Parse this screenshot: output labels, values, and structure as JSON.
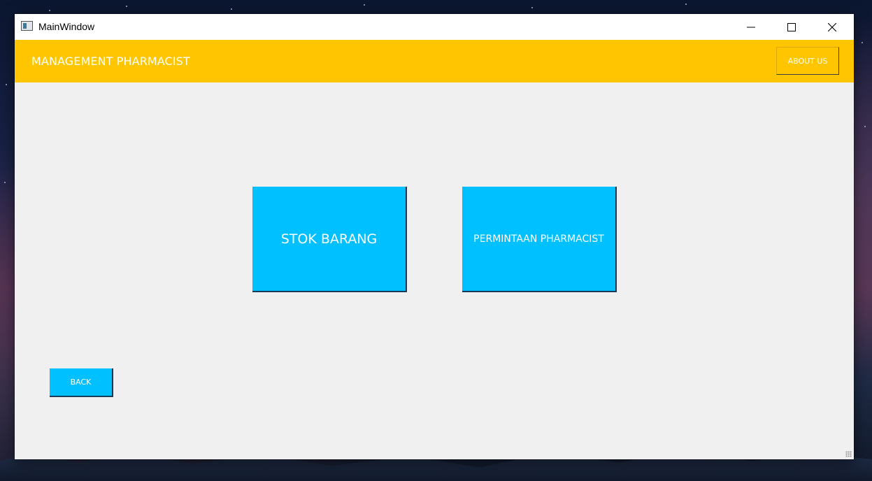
{
  "window": {
    "title": "MainWindow",
    "icons": {
      "app": "app-window-icon",
      "minimize": "minimize-icon",
      "maximize": "maximize-icon",
      "close": "close-icon"
    }
  },
  "header": {
    "title": "MANAGEMENT PHARMACIST",
    "about_label": "ABOUT US",
    "background_color": "#ffc600"
  },
  "main": {
    "tiles": [
      {
        "label": "STOK BARANG"
      },
      {
        "label": "PERMINTAAN PHARMACIST"
      }
    ],
    "back_label": "BACK",
    "button_color": "#00c0ff",
    "background_color": "#f0f0f0"
  }
}
